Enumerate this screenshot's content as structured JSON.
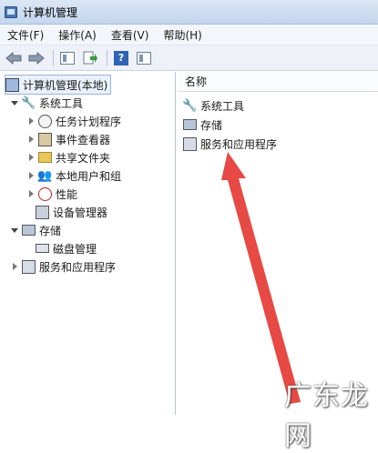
{
  "window": {
    "title": "计算机管理"
  },
  "menu": [
    {
      "label": "文件(F)"
    },
    {
      "label": "操作(A)"
    },
    {
      "label": "查看(V)"
    },
    {
      "label": "帮助(H)"
    }
  ],
  "toolbar": {
    "help_glyph": "?"
  },
  "tree": {
    "root": "计算机管理(本地)",
    "system_tools": "系统工具",
    "task_scheduler": "任务计划程序",
    "event_viewer": "事件查看器",
    "shared_folders": "共享文件夹",
    "local_users": "本地用户和组",
    "performance": "性能",
    "device_manager": "设备管理器",
    "storage": "存储",
    "disk_management": "磁盘管理",
    "services_apps": "服务和应用程序"
  },
  "list": {
    "column_name": "名称",
    "items": [
      {
        "label": "系统工具"
      },
      {
        "label": "存储"
      },
      {
        "label": "服务和应用程序"
      }
    ]
  },
  "watermark": "广东龙网"
}
